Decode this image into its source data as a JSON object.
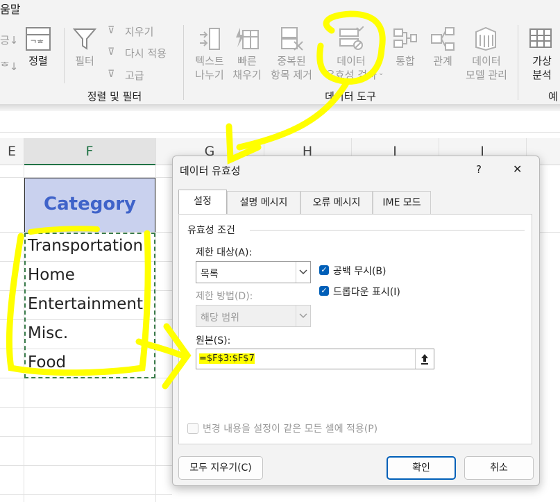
{
  "ribbon": {
    "top_tab_partial": "움말",
    "left_partial_top": "긍↓",
    "left_partial_bottom": "ᄒ↓",
    "sort_label": "정렬",
    "filter_label": "필터",
    "clear_label": "지우기",
    "reapply_label": "다시 적용",
    "advanced_label": "고급",
    "group_sort_filter": "정렬 및 필터",
    "text_to_columns_line1": "텍스트",
    "text_to_columns_line2": "나누기",
    "flash_fill_line1": "빠른",
    "flash_fill_line2": "채우기",
    "remove_dup_line1": "중복된",
    "remove_dup_line2": "항목 제거",
    "data_validation_line1": "데이터",
    "data_validation_line2": "유효성 검사",
    "consolidate_label": "통합",
    "relationships_label": "관계",
    "data_model_line1": "데이터",
    "data_model_line2": "모델 관리",
    "group_data_tools": "데이터 도구",
    "whatif_line1": "가상",
    "whatif_line2": "분석",
    "group_partial_right": "예"
  },
  "sheet": {
    "columns": [
      "E",
      "F",
      "G",
      "H",
      "I",
      "J"
    ],
    "header_cell": "Category",
    "rows": [
      "Transportation",
      "Home",
      "Entertainment",
      "Misc.",
      "Food"
    ]
  },
  "dialog": {
    "title": "데이터 유효성",
    "help": "?",
    "close": "✕",
    "tabs": [
      "설정",
      "설명 메시지",
      "오류 메시지",
      "IME 모드"
    ],
    "section_title": "유효성 조건",
    "allow_label": "제한 대상(A):",
    "allow_value": "목록",
    "data_label": "제한 방법(D):",
    "data_value": "해당 범위",
    "ignore_blank_label": "공백 무시(B)",
    "dropdown_label": "드롭다운 표시(I)",
    "source_label": "원본(S):",
    "source_value": "=$F$3:$F$7",
    "apply_all_label": "변경 내용을 설정이 같은 모든 셀에 적용(P)",
    "clear_all_button": "모두 지우기(C)",
    "ok_button": "확인",
    "cancel_button": "취소"
  },
  "colors": {
    "highlight": "#ffff00",
    "header_fill": "#c9d1ee",
    "header_text": "#3f63c9",
    "accent": "#005fb8",
    "excel_green": "#217346"
  }
}
